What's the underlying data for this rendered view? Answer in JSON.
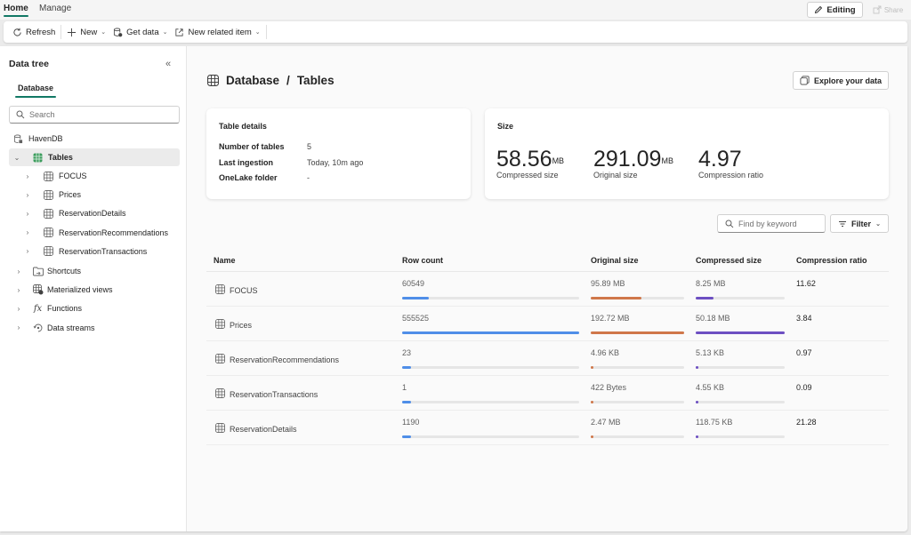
{
  "top_tabs": [
    {
      "label": "Home",
      "active": true
    },
    {
      "label": "Manage",
      "active": false
    }
  ],
  "top_actions": {
    "editing_label": "Editing",
    "share_label": "Share"
  },
  "toolbar": {
    "refresh_label": "Refresh",
    "new_label": "New",
    "get_data_label": "Get data",
    "new_related_label": "New related item"
  },
  "sidebar": {
    "title": "Data tree",
    "tab": "Database",
    "search_placeholder": "Search",
    "database": "HavenDB",
    "tables_label": "Tables",
    "tables": [
      "FOCUS",
      "Prices",
      "ReservationDetails",
      "ReservationRecommendations",
      "ReservationTransactions"
    ],
    "other_nodes": [
      {
        "label": "Shortcuts",
        "icon": "shortcut-folder-icon"
      },
      {
        "label": "Materialized views",
        "icon": "materialized-view-icon"
      },
      {
        "label": "Functions",
        "icon": "function-icon"
      },
      {
        "label": "Data streams",
        "icon": "data-stream-icon"
      }
    ]
  },
  "main": {
    "breadcrumb": {
      "root": "Database",
      "sep": "/",
      "current": "Tables"
    },
    "explore_label": "Explore your data",
    "table_details": {
      "title": "Table details",
      "rows": [
        {
          "label": "Number of tables",
          "value": "5"
        },
        {
          "label": "Last ingestion",
          "value": "Today, 10m ago"
        },
        {
          "label": "OneLake folder",
          "value": "-"
        }
      ]
    },
    "size": {
      "title": "Size",
      "stats": [
        {
          "value": "58.56",
          "unit": "MB",
          "label": "Compressed size"
        },
        {
          "value": "291.09",
          "unit": "MB",
          "label": "Original size"
        },
        {
          "value": "4.97",
          "unit": "",
          "label": "Compression ratio"
        }
      ]
    },
    "find_placeholder": "Find by keyword",
    "filter_label": "Filter",
    "table": {
      "columns": [
        "Name",
        "Row count",
        "Original size",
        "Compressed size",
        "Compression ratio"
      ],
      "colors": {
        "row_count": "#4f8ee8",
        "original": "#d0774a",
        "compressed": "#6d4fc2",
        "track": "#e6e6e6"
      },
      "rows": [
        {
          "name": "FOCUS",
          "row_count": "60549",
          "row_pct": 15,
          "original": "95.89 MB",
          "orig_pct": 54,
          "compressed": "8.25 MB",
          "comp_pct": 20,
          "ratio": "11.62"
        },
        {
          "name": "Prices",
          "row_count": "555525",
          "row_pct": 100,
          "original": "192.72 MB",
          "orig_pct": 100,
          "compressed": "50.18 MB",
          "comp_pct": 100,
          "ratio": "3.84"
        },
        {
          "name": "ReservationRecommendations",
          "row_count": "23",
          "row_pct": 5,
          "original": "4.96 KB",
          "orig_pct": 3,
          "compressed": "5.13 KB",
          "comp_pct": 3,
          "ratio": "0.97"
        },
        {
          "name": "ReservationTransactions",
          "row_count": "1",
          "row_pct": 5,
          "original": "422 Bytes",
          "orig_pct": 3,
          "compressed": "4.55 KB",
          "comp_pct": 3,
          "ratio": "0.09"
        },
        {
          "name": "ReservationDetails",
          "row_count": "1190",
          "row_pct": 5,
          "original": "2.47 MB",
          "orig_pct": 3,
          "compressed": "118.75 KB",
          "comp_pct": 3,
          "ratio": "21.28"
        }
      ]
    }
  }
}
